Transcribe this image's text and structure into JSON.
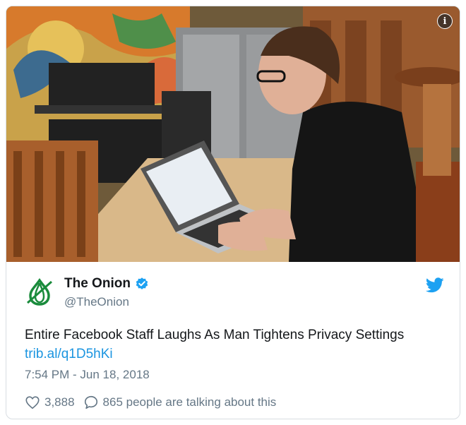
{
  "photo": {
    "alt_scene": "man-typing-on-laptop",
    "info_glyph": "i"
  },
  "tweet": {
    "author_name": "The Onion",
    "handle": "@TheOnion",
    "text": "Entire Facebook Staff Laughs As Man Tightens Privacy Settings",
    "link": "trib.al/q1D5hKi",
    "timestamp": "7:54 PM - Jun 18, 2018",
    "likes": "3,888",
    "talking": "865 people are talking about this"
  },
  "colors": {
    "link": "#1b95e0",
    "verified": "#1da1f2",
    "onion_green": "#1a8b3c",
    "muted": "#657786"
  },
  "icons": {
    "verified": "verified-badge-icon",
    "bird": "twitter-bird-icon",
    "like": "heart-icon",
    "reply": "speech-bubble-icon",
    "logo": "onion-logo-icon"
  }
}
